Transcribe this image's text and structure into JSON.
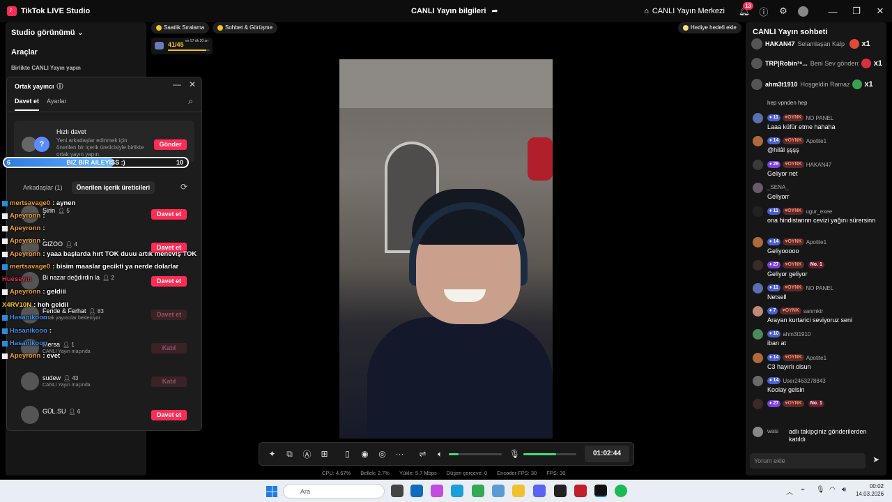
{
  "titlebar": {
    "app_name": "TikTok LIVE Studio",
    "center_title": "CANLI Yayın bilgileri",
    "live_center": "CANLI Yayın Merkezi",
    "notification_count": "13"
  },
  "left": {
    "studio_view": "Studio görünümü",
    "tools_title": "Araçlar",
    "together_live": "Birlikte CANLI Yayın yapın"
  },
  "cohost": {
    "title": "Ortak yayıncı",
    "tab_invite": "Davet et",
    "tab_settings": "Ayarlar",
    "quick_title": "Hızlı davet",
    "quick_desc": "Yeni arkadaşlar edinmek için önerilen bir içerik üreticisiyle birlikte ortak yayın yapın",
    "quick_button": "Gönder",
    "subtab_friends": "Arkadaşlar (1)",
    "subtab_suggested": "Önerilen içerik üreticileri",
    "creators": [
      {
        "name": "Şirin",
        "count": "5",
        "sub": "",
        "button": "Davet et",
        "enabled": true
      },
      {
        "name": "GIZOO",
        "count": "4",
        "sub": "",
        "button": "Davet et",
        "enabled": true
      },
      {
        "name": "Bi nazar değdirdin la",
        "count": "2",
        "sub": "",
        "button": "Davet et",
        "enabled": true
      },
      {
        "name": "Feride & Ferhat",
        "count": "83",
        "sub": "Ortak yayıncılar bekleniyor",
        "button": "Davet et",
        "enabled": false
      },
      {
        "name": "Mersa",
        "count": "1",
        "sub": "CANLI Yayın maçında",
        "button": "Katıl",
        "enabled": false
      },
      {
        "name": "sudew",
        "count": "43",
        "sub": "CANLI Yayın maçında",
        "button": "Katıl",
        "enabled": false
      },
      {
        "name": "GÜL.SU",
        "count": "6",
        "sub": "",
        "button": "Davet et",
        "enabled": true
      }
    ]
  },
  "goal": {
    "start": "6",
    "text": "BIZ BIR AILEYISS :)",
    "end": "10",
    "progress": 0.6
  },
  "overlay_chat": [
    {
      "user": "mertsavage0",
      "msg": ": aynen",
      "color": "#f0a030",
      "icon": "blue"
    },
    {
      "user": "Apeyronn",
      "msg": ":",
      "color": "#f0a030",
      "icon": "white"
    },
    {
      "user": "Apeyronn",
      "msg": ":",
      "color": "#f0a030",
      "icon": "white"
    },
    {
      "user": "Apeyronn",
      "msg": ":",
      "color": "#f0a030",
      "icon": "white"
    },
    {
      "user": "Apeyronn",
      "msg": ": yaaa başlarda hırt TOK duuu artık meneviş TOK",
      "color": "#f0a030",
      "icon": "white"
    },
    {
      "user": "mertsavage0",
      "msg": ": bisim maaslar gecikti ya nerde dolarlar",
      "color": "#f0a030",
      "icon": "blue"
    },
    {
      "user": "Hueseyin",
      "msg": "",
      "color": "#e0304a",
      "icon": ""
    },
    {
      "user": "Apeyronn",
      "msg": ": geldiii",
      "color": "#f0a030",
      "icon": "white"
    },
    {
      "user": "X4RV10N",
      "msg": ": heh geldil",
      "color": "#f0c020",
      "icon": ""
    },
    {
      "user": "Hasanikooo",
      "msg": "",
      "color": "#3a8ff0",
      "icon": "blue"
    },
    {
      "user": "Hasanikooo",
      "msg": ":",
      "color": "#3a8ff0",
      "icon": "blue"
    },
    {
      "user": "Hasanikooo",
      "msg": "",
      "color": "#3a8ff0",
      "icon": "blue"
    },
    {
      "user": "Apeyronn",
      "msg": ": evet",
      "color": "#f0a030",
      "icon": "white"
    }
  ],
  "pills": {
    "hourly": "Saatlik Sıralama",
    "chat_meet": "Sohbet & Görüşme",
    "gift_goal": "Hediye hedefi ekle"
  },
  "hourly_card": {
    "value": "41/45",
    "time": "ee 57 dk 20 sn",
    "progress": 0.91
  },
  "chat": {
    "title": "CANLI Yayın sohbeti",
    "pinned": [
      {
        "name": "HAKAN47",
        "msg": "Selamlaşan Kalp gönderdi",
        "x": "x1"
      },
      {
        "name": "TRP|Robin¹⁹...",
        "msg": "Beni Sev gönderdi",
        "x": "x1"
      },
      {
        "name": "ahm3t1910",
        "msg": "Hoşgeldin Ramazan gönderdi",
        "x": "x1"
      }
    ],
    "partial": "hep vpnden hep",
    "messages": [
      {
        "level": "11",
        "fan": "OYNK",
        "user": "NO PANEL",
        "text": "Laaa küfür etme hahaha",
        "purple": false,
        "no1": false
      },
      {
        "level": "14",
        "fan": "OYNK",
        "user": "Apotite1",
        "text": "@hilâl şşşş",
        "purple": false,
        "no1": false
      },
      {
        "level": "29",
        "fan": "OYNK",
        "user": "HAKAN47",
        "text": "Geliyor net",
        "purple": true,
        "no1": false
      },
      {
        "level": "",
        "fan": "",
        "user": "_SENA_",
        "text": "Geliyorr",
        "purple": false,
        "no1": false
      },
      {
        "level": "11",
        "fan": "OYNK",
        "user": "ugur_exee",
        "text": "ona hindistannn cevizi yağını sürersinn",
        "purple": false,
        "no1": false
      },
      {
        "level": "14",
        "fan": "OYNK",
        "user": "Apotite1",
        "text": "Geliyooooo",
        "purple": false,
        "no1": false
      },
      {
        "level": "27",
        "fan": "OYNK",
        "user": "",
        "text": "Geliyor geliyor",
        "purple": true,
        "no1": true
      },
      {
        "level": "11",
        "fan": "OYNK",
        "user": "NO PANEL",
        "text": "Netsell",
        "purple": false,
        "no1": false
      },
      {
        "level": "7",
        "fan": "OYNK",
        "user": "sanmktr",
        "text": "Arayan kurtarici seviyoruz seni",
        "purple": false,
        "no1": false
      },
      {
        "level": "10",
        "fan": "",
        "user": "ahm3t1910",
        "text": "iban at",
        "purple": false,
        "no1": false
      },
      {
        "level": "14",
        "fan": "OYNK",
        "user": "Apotite1",
        "text": "C3 hayırlı olsun",
        "purple": false,
        "no1": false
      },
      {
        "level": "14",
        "fan": "",
        "user": "User2463278843",
        "text": "Koolay gelsin",
        "purple": false,
        "no1": false
      },
      {
        "level": "27",
        "fan": "OYNK",
        "user": "",
        "text": "",
        "purple": true,
        "no1": true
      }
    ],
    "no1_label": "No. 1",
    "follow_user": "wais",
    "follow_text": "adlı takipçiniz gönderilerden katıldı",
    "input_placeholder": "Yorum ekle"
  },
  "controls": {
    "timer": "01:02:44",
    "speaker_level": 0.18,
    "mic_level": 0.62
  },
  "stats": {
    "cpu": "CPU:  4.67%",
    "memory": "Bellek:  2.7%",
    "upload": "Yükle:  5.7 Mbps",
    "dropped": "Düşen çerçeve:  0",
    "encoder": "Encoder FPS:  30",
    "fps": "FPS:  30"
  },
  "taskbar": {
    "search": "Ara",
    "time": "00:02",
    "date": "14.03.2026"
  },
  "colors": {
    "accent": "#ff2d55",
    "level_blue": "#4a5fd0",
    "level_purple": "#7b3fe0",
    "green": "#3ce07a"
  }
}
